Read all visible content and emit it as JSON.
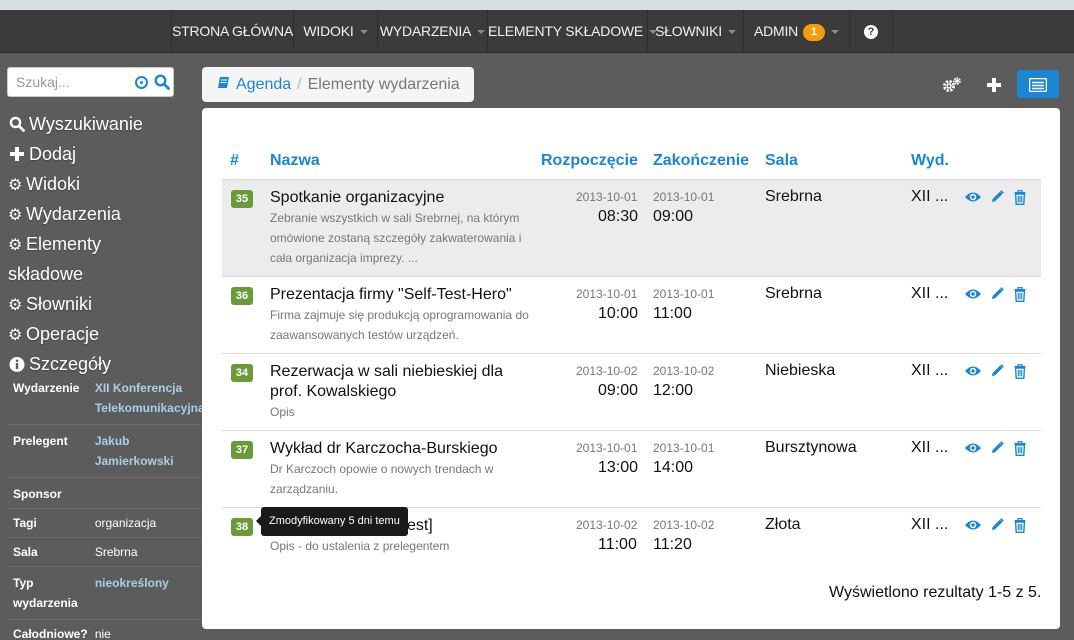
{
  "nav": {
    "items": [
      {
        "label": "STRONA GŁÓWNA",
        "caret": false
      },
      {
        "label": "WIDOKI",
        "caret": true
      },
      {
        "label": "WYDARZENIA",
        "caret": true
      },
      {
        "label": "ELEMENTY SKŁADOWE",
        "caret": true
      },
      {
        "label": "SŁOWNIKI",
        "caret": true
      },
      {
        "label": "ADMIN",
        "caret": true,
        "badge": "1"
      }
    ],
    "help_icon": "?"
  },
  "search": {
    "placeholder": "Szukaj..."
  },
  "sidebar": {
    "menu": [
      {
        "icon": "search-icon",
        "label": "Wyszukiwanie"
      },
      {
        "icon": "plus-icon",
        "label": "Dodaj"
      },
      {
        "icon": "gear-icon",
        "label": "Widoki"
      },
      {
        "icon": "gear-icon",
        "label": "Wydarzenia"
      },
      {
        "icon": "gear-icon",
        "label": "Elementy"
      },
      {
        "icon": "",
        "label": "składowe"
      },
      {
        "icon": "gear-icon",
        "label": "Słowniki"
      },
      {
        "icon": "gear-icon",
        "label": "Operacje"
      },
      {
        "icon": "info-icon",
        "label": "Szczegóły"
      }
    ],
    "details": [
      {
        "label": "Wydarzenie",
        "value": "XII Konferencja Telekomunikacyjna",
        "link": true
      },
      {
        "label": "Prelegent",
        "value": "Jakub Jamierkowski",
        "link": true
      },
      {
        "label": "Sponsor",
        "value": "",
        "link": false
      },
      {
        "label": "Tagi",
        "value": "organizacja",
        "link": false
      },
      {
        "label": "Sala",
        "value": "Srebrna",
        "link": false
      },
      {
        "label": "Typ wydarzenia",
        "value": "nieokreślony",
        "link": true
      },
      {
        "label": "Całodniowe?",
        "value": "nie",
        "link": false
      }
    ]
  },
  "breadcrumb": {
    "root": "Agenda",
    "separator": "/",
    "current": "Elementy wydarzenia"
  },
  "table": {
    "headers": {
      "id": "#",
      "name": "Nazwa",
      "start": "Rozpoczęcie",
      "end": "Zakończenie",
      "room": "Sala",
      "event": "Wyd."
    },
    "rows": [
      {
        "id": "35",
        "title": "Spotkanie organizacyjne",
        "desc": "Zebranie wszystkich w sali Srebrnej, na którym omówione zostaną szczegóły zakwaterowania i cała organizacja imprezy. ...",
        "start_date": "2013-10-01",
        "start_time": "08:30",
        "end_date": "2013-10-01",
        "end_time": "09:00",
        "room": "Srebrna",
        "event": "XII ..."
      },
      {
        "id": "36",
        "title": "Prezentacja firmy \"Self-Test-Hero\"",
        "desc": "Firma zajmuje się produkcją oprogramowania do zaawansowanych testów urządzeń.",
        "start_date": "2013-10-01",
        "start_time": "10:00",
        "end_date": "2013-10-01",
        "end_time": "11:00",
        "room": "Srebrna",
        "event": "XII ..."
      },
      {
        "id": "34",
        "title": "Rezerwacja w sali niebieskiej dla prof. Kowalskiego",
        "desc": "Opis",
        "start_date": "2013-10-02",
        "start_time": "09:00",
        "end_date": "2013-10-02",
        "end_time": "12:00",
        "room": "Niebieska",
        "event": "XII ..."
      },
      {
        "id": "37",
        "title": "Wykład dr Karczocha-Burskiego",
        "desc": "Dr Karczoch opowie o nowych trendach w zarządzaniu.",
        "start_date": "2013-10-01",
        "start_time": "13:00",
        "end_date": "2013-10-01",
        "end_time": "14:00",
        "room": "Bursztynowa",
        "event": "XII ..."
      },
      {
        "id": "38",
        "title": "Praktyka robocza [test]",
        "desc": "Opis - do ustalenia z prelegentem",
        "start_date": "2013-10-02",
        "start_time": "11:00",
        "end_date": "2013-10-02",
        "end_time": "11:20",
        "room": "Złota",
        "event": "XII ..."
      }
    ]
  },
  "tooltip": "Zmodyfikowany 5 dni temu",
  "results": "Wyświetlono rezultaty 1-5 z 5.",
  "colors": {
    "accent": "#1b87d3",
    "badge_green": "#6a9a3a",
    "badge_orange": "#f39c12"
  }
}
